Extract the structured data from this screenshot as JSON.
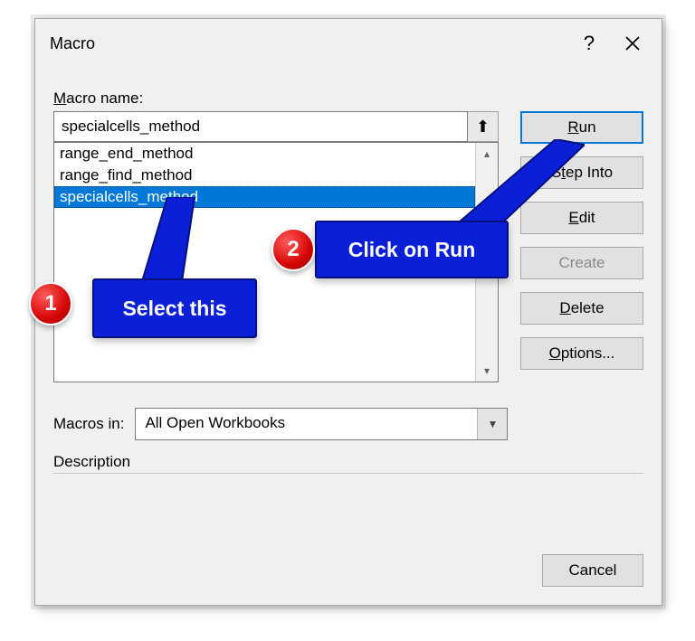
{
  "dialog": {
    "title": "Macro",
    "macro_name_label": "Macro name:",
    "macro_name_label_ul": "M",
    "macro_name_value": "specialcells_method",
    "list": [
      "range_end_method",
      "range_find_method",
      "specialcells_method"
    ],
    "selected_index": 2,
    "macros_in_label": "Macros in:",
    "macros_in_label_without": "acros in:",
    "macros_in_value": "All Open Workbooks",
    "description_label": "Description"
  },
  "buttons": {
    "run": "Run",
    "run_ul": "R",
    "run_rest": "un",
    "step_into_pre": "S",
    "step_into_ul": "t",
    "step_into_rest": "ep Into",
    "edit_ul": "E",
    "edit_rest": "dit",
    "create": "Create",
    "delete_ul": "D",
    "delete_rest": "elete",
    "options_ul": "O",
    "options_rest": "ptions...",
    "cancel": "Cancel"
  },
  "callouts": {
    "c1_text": "Select this",
    "c1_num": "1",
    "c2_text": "Click on Run",
    "c2_num": "2"
  }
}
